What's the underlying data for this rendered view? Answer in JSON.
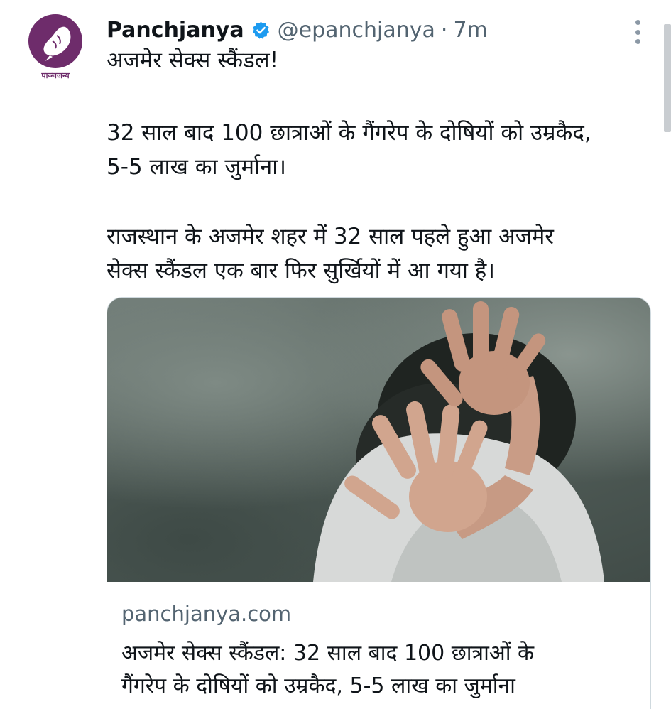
{
  "account": {
    "name": "Panchjanya",
    "handle": "@epanchjanya",
    "separator": "·",
    "time": "7m",
    "verified": true,
    "avatar_caption": "पाञ्चजन्य",
    "avatar_icon": "conch-shell-icon",
    "avatar_color": "#6e2c6b"
  },
  "tweet": {
    "line1": "अजमेर सेक्स स्कैंडल!",
    "line2": "32 साल बाद 100 छात्राओं के गैंगरेप के दोषियों को उम्रकैद,",
    "line3": "5-5 लाख का जुर्माना।",
    "line4": "राजस्थान के अजमेर शहर में 32 साल पहले हुआ अजमेर",
    "line5": "सेक्स स्कैंडल एक बार फिर सुर्खियों में आ गया है।"
  },
  "card": {
    "domain": "panchjanya.com",
    "title_line1": "अजमेर सेक्स स्कैंडल: 32 साल बाद 100 छात्राओं के",
    "title_line2": "गैंगरेप के दोषियों को उम्रकैद, 5-5 लाख का जुर्माना"
  },
  "icons": {
    "verified": "verified-badge-icon",
    "more": "more-options-icon"
  },
  "colors": {
    "verified_blue": "#1d9bf0",
    "secondary_text": "#536471",
    "primary_text": "#0f1419",
    "border": "#cfd9de"
  }
}
